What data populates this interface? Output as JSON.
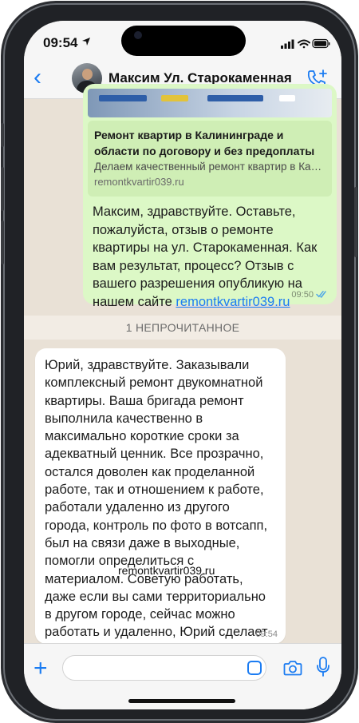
{
  "status_bar": {
    "time": "09:54"
  },
  "header": {
    "contact_name": "Максим Ул. Старокаменная"
  },
  "messages": {
    "outgoing": {
      "preview_title": "Ремонт квартир в Калининграде и области по договору и без предоплаты",
      "preview_description": "Делаем качественный ремонт квартир в Калини...",
      "preview_url": "remontkvartir039.ru",
      "text": "Максим, здравствуйте. Оставьте, пожалуйста, отзыв о ремонте квартиры на ул. Старокаменная. Как вам результат, процесс? Отзыв с вашего разрешения опубликую на нашем сайте ",
      "link": "remontkvartir039.ru",
      "time": "09:50",
      "status": "read"
    },
    "unread_divider": "1 НЕПРОЧИТАННОЕ",
    "incoming": {
      "text": "Юрий, здравствуйте. Заказывали комплексный ремонт двукомнатной квартиры. Ваша бригада ремонт выполнила качественно в максимально короткие сроки за адекватный ценник. Все прозрачно, остался доволен как проделанной работе, так и отношением к работе, работали удаленно из другого города, контроль по фото в вотсапп, был на связи даже в выходные, помогли определиться с материалом. Советую работать, даже если вы сами территориально в другом городе, сейчас можно работать и удаленно, Юрий сделает все красиво. Спасибо вам",
      "time": "09:54"
    }
  },
  "watermark": "remontkvartir039.ru",
  "accent_color": "#1b7cf2"
}
